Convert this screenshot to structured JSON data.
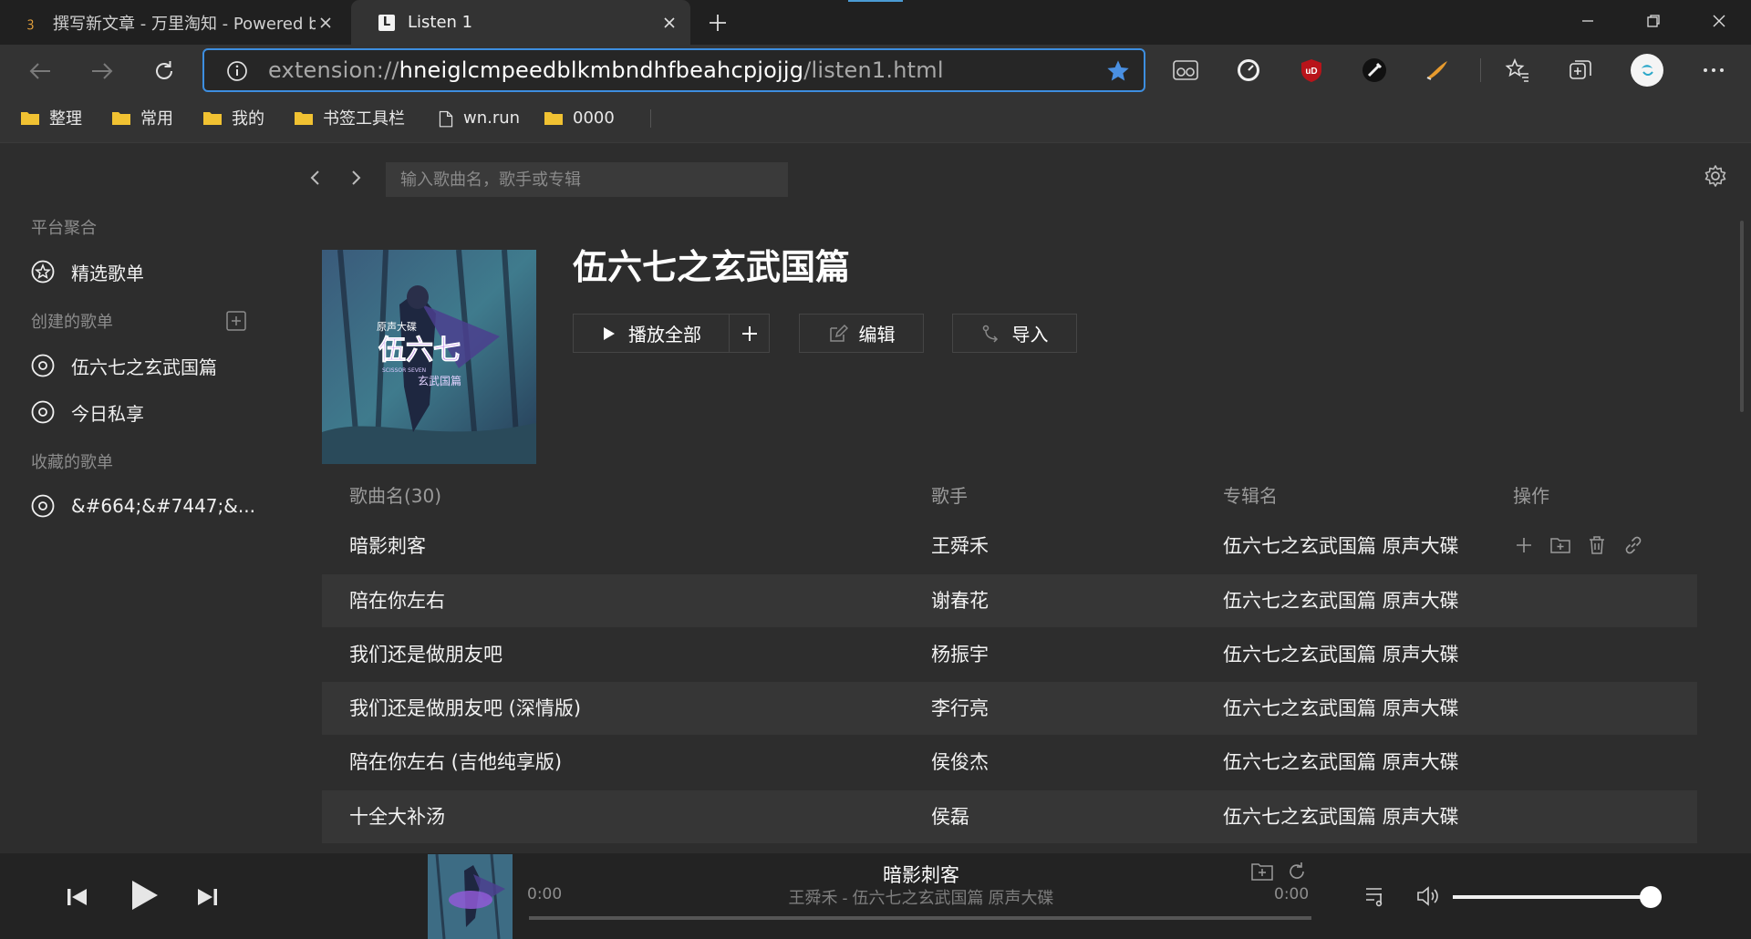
{
  "browser": {
    "tabs": [
      {
        "title": "撰写新文章 - 万里淘知 - Powered by",
        "active": false,
        "icon": "wordpress-favicon-icon"
      },
      {
        "title": "Listen 1",
        "active": true,
        "icon": "listen1-favicon-icon"
      }
    ],
    "address": {
      "scheme": "extension://",
      "host": "hneiglcmpeedblkmbndhfbeahcpjojjg",
      "path": "/listen1.html"
    },
    "bookmarks": [
      {
        "label": "整理",
        "icon": "folder-icon"
      },
      {
        "label": "常用",
        "icon": "folder-icon"
      },
      {
        "label": "我的",
        "icon": "folder-icon"
      },
      {
        "label": "书签工具栏",
        "icon": "folder-icon"
      },
      {
        "label": "wn.run",
        "icon": "page-icon"
      },
      {
        "label": "0000",
        "icon": "folder-icon"
      }
    ],
    "accent": "#3d8ee0"
  },
  "app": {
    "search_placeholder": "输入歌曲名，歌手或专辑",
    "sidebar": {
      "platform_heading": "平台聚合",
      "featured_label": "精选歌单",
      "created_heading": "创建的歌单",
      "created_items": [
        "伍六七之玄武国篇",
        "今日私享"
      ],
      "favorites_heading": "收藏的歌单",
      "favorite_items": [
        "&#664;&#7447;&..."
      ]
    },
    "playlist": {
      "title": "伍六七之玄武国篇",
      "cover_text_a": "原声大碟",
      "cover_text_b": "伍六七",
      "cover_text_c": "玄武国篇",
      "cover_text_d": "SCISSOR SEVEN",
      "play_all_label": "播放全部",
      "edit_label": "编辑",
      "import_label": "导入"
    },
    "table": {
      "headers": {
        "song": "歌曲名(30)",
        "artist": "歌手",
        "album": "专辑名",
        "ops": "操作"
      },
      "rows": [
        {
          "song": "暗影刺客",
          "artist": "王舜禾",
          "album": "伍六七之玄武国篇 原声大碟"
        },
        {
          "song": "陪在你左右",
          "artist": "谢春花",
          "album": "伍六七之玄武国篇 原声大碟"
        },
        {
          "song": "我们还是做朋友吧",
          "artist": "杨振宇",
          "album": "伍六七之玄武国篇 原声大碟"
        },
        {
          "song": "我们还是做朋友吧 (深情版)",
          "artist": "李行亮",
          "album": "伍六七之玄武国篇 原声大碟"
        },
        {
          "song": "陪在你左右 (吉他纯享版)",
          "artist": "侯俊杰",
          "album": "伍六七之玄武国篇 原声大碟"
        },
        {
          "song": "十全大补汤",
          "artist": "侯磊",
          "album": "伍六七之玄武国篇 原声大碟"
        }
      ]
    }
  },
  "player": {
    "title": "暗影刺客",
    "subtitle": "王舜禾 - 伍六七之玄武国篇 原声大碟",
    "time_current": "0:00",
    "time_total": "0:00",
    "progress": 0,
    "volume": 0.95
  }
}
